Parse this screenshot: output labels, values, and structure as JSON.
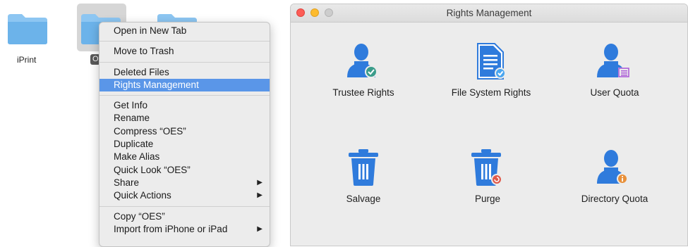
{
  "desktop": {
    "folders": [
      {
        "label": "iPrint"
      },
      {
        "label": "O"
      },
      {
        "label": ""
      }
    ]
  },
  "context_menu": {
    "groups": [
      [
        "Open in New Tab"
      ],
      [
        "Move to Trash"
      ],
      [
        "Deleted Files",
        "Rights Management"
      ],
      [
        "Get Info",
        "Rename",
        "Compress “OES”",
        "Duplicate",
        "Make Alias",
        "Quick Look “OES”",
        "Share",
        "Quick Actions"
      ],
      [
        "Copy “OES”",
        "Import from iPhone or iPad"
      ]
    ],
    "highlighted": "Rights Management"
  },
  "window": {
    "title": "Rights Management",
    "tiles": [
      {
        "label": "Trustee Rights",
        "icon": "user-check-icon"
      },
      {
        "label": "File System Rights",
        "icon": "document-check-icon"
      },
      {
        "label": "User Quota",
        "icon": "user-list-icon"
      },
      {
        "label": "Salvage",
        "icon": "trash-icon"
      },
      {
        "label": "Purge",
        "icon": "trash-purge-icon"
      },
      {
        "label": "Directory Quota",
        "icon": "user-info-icon"
      }
    ],
    "colors": {
      "accent": "#2f7bdc",
      "check": "#3a9c8a",
      "purple": "#a855d6",
      "orange": "#e8903a",
      "red": "#e05a4a"
    }
  }
}
